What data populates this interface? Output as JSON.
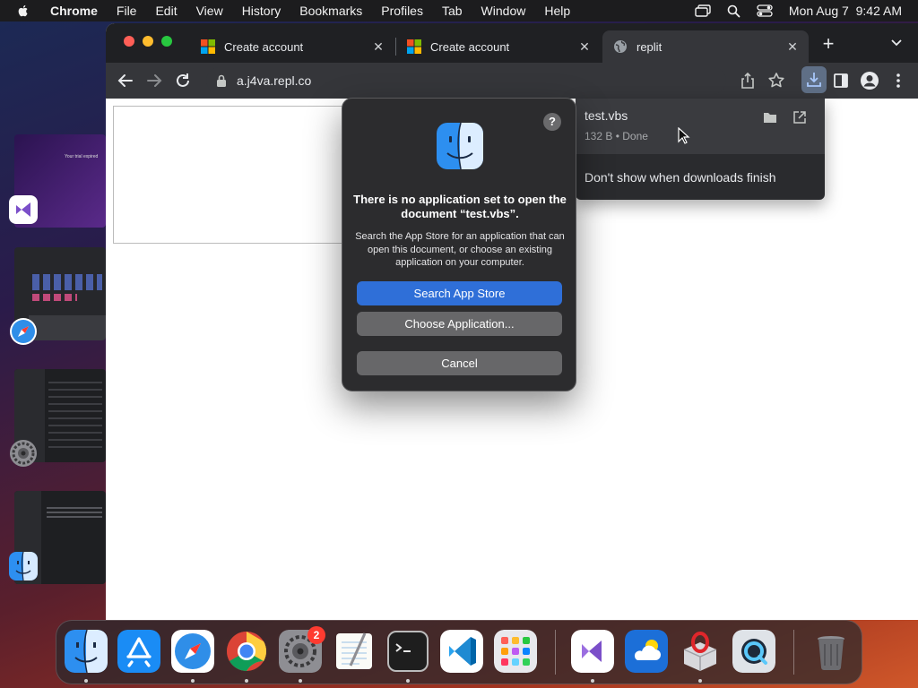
{
  "menubar": {
    "app_name": "Chrome",
    "items": [
      "File",
      "Edit",
      "View",
      "History",
      "Bookmarks",
      "Profiles",
      "Tab",
      "Window",
      "Help"
    ],
    "clock": "Mon Aug 7  9:42 AM",
    "icons": [
      "apple-icon",
      "screen-mirroring-icon",
      "spotlight-search-icon",
      "control-center-icon"
    ]
  },
  "browser": {
    "tabs": [
      {
        "title": "Create account",
        "favicon": "microsoft-logo-icon",
        "active": false
      },
      {
        "title": "Create account",
        "favicon": "microsoft-logo-icon",
        "active": false
      },
      {
        "title": "replit",
        "favicon": "globe-icon",
        "active": true
      }
    ],
    "new_tab_symbol": "+",
    "address": "a.j4va.repl.co"
  },
  "downloads_bubble": {
    "file_name": "test.vbs",
    "file_status": "132 B • Done",
    "footer_option": "Don't show when downloads finish"
  },
  "dialog": {
    "help_symbol": "?",
    "title": "There is no application set to open the document “test.vbs”.",
    "message": "Search the App Store for an application that can open this document, or choose an existing application on your computer.",
    "primary_button": "Search App Store",
    "secondary_button": "Choose Application...",
    "cancel_button": "Cancel"
  },
  "stage_manager": {
    "thumb_text": "Your trial expired"
  },
  "dock": {
    "apps": [
      "finder",
      "app-store",
      "safari",
      "chrome",
      "system-settings",
      "textedit",
      "terminal",
      "vscode",
      "launchpad",
      "visual-studio",
      "weather",
      "opera-gx",
      "quicktime",
      "trash"
    ],
    "settings_badge": "2"
  },
  "colors": {
    "accent_blue": "#2f6fd8",
    "dialog_bg": "#2c2c2e",
    "chrome_dark": "#35363a",
    "dock_badge": "#ff3b30"
  }
}
